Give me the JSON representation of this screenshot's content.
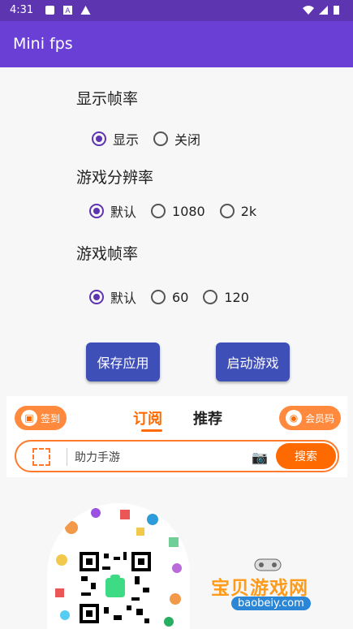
{
  "status_bar": {
    "time": "4:31"
  },
  "app_bar": {
    "title": "Mini fps"
  },
  "settings": {
    "display_fps": {
      "label": "显示帧率",
      "options": [
        "显示",
        "关闭"
      ],
      "selected": "显示"
    },
    "resolution": {
      "label": "游戏分辨率",
      "options": [
        "默认",
        "1080",
        "2k"
      ],
      "selected": "默认"
    },
    "game_fps": {
      "label": "游戏帧率",
      "options": [
        "默认",
        "60",
        "120"
      ],
      "selected": "默认"
    }
  },
  "buttons": {
    "save": "保存应用",
    "launch": "启动游戏"
  },
  "ad": {
    "checkin": "签到",
    "tab_subscribe": "订阅",
    "tab_recommend": "推荐",
    "member_code": "会员码",
    "search_placeholder": "助力手游",
    "search_button": "搜索"
  },
  "watermark": {
    "title": "宝贝游戏网",
    "url": "baobeiy.com"
  },
  "colors": {
    "accent": "#6a3fd6",
    "button": "#3f4fb8",
    "ad_orange": "#ff6a00"
  }
}
